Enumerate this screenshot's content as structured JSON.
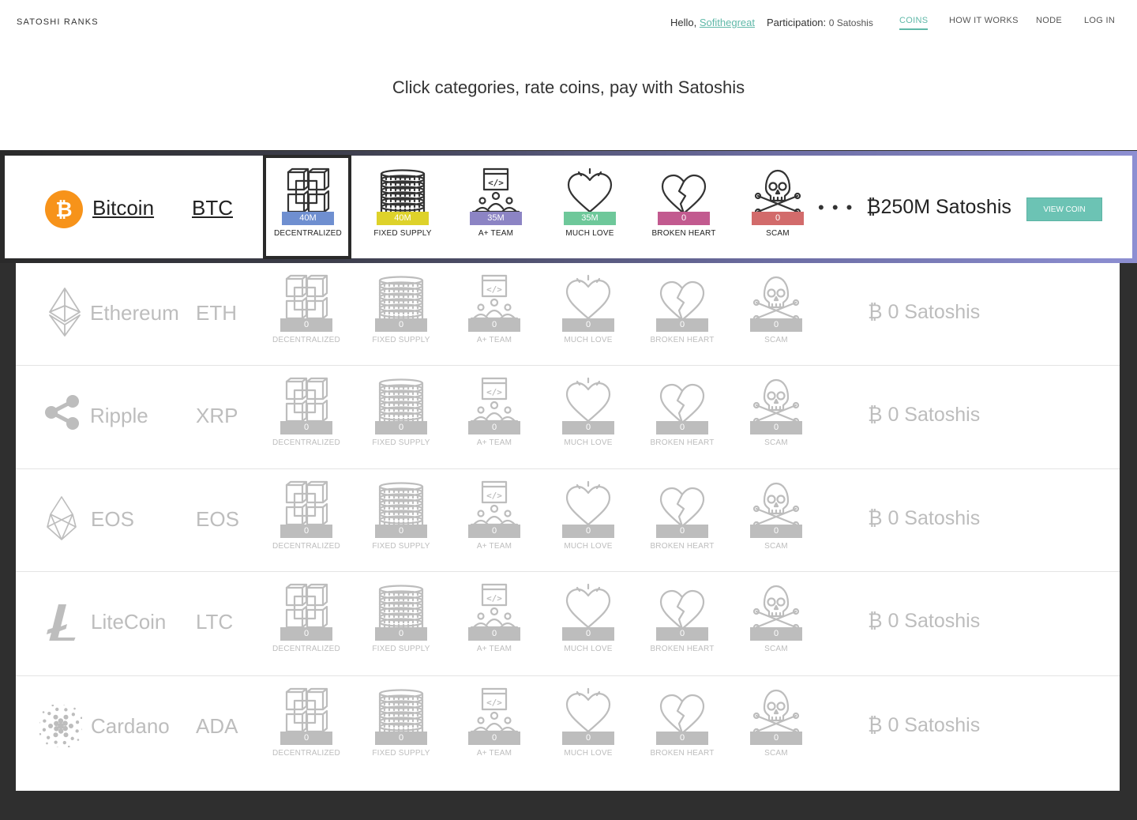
{
  "header": {
    "brand": "SATOSHI RANKS",
    "greeting_prefix": "Hello,",
    "username": "Sofithegreat",
    "participation_label": "Participation:",
    "participation_value": "0 Satoshis",
    "nav": [
      {
        "label": "COINS",
        "active": true
      },
      {
        "label": "HOW IT WORKS",
        "active": false
      },
      {
        "label": "NODE",
        "active": false
      },
      {
        "label": "LOG IN",
        "active": false
      }
    ]
  },
  "tagline": "Click categories, rate coins, pay with Satoshis",
  "categories": [
    {
      "label": "DECENTRALIZED",
      "icon": "blocks-icon"
    },
    {
      "label": "FIXED SUPPLY",
      "icon": "coin-stack-icon"
    },
    {
      "label": "A+ TEAM",
      "icon": "team-icon"
    },
    {
      "label": "MUCH LOVE",
      "icon": "heart-icon"
    },
    {
      "label": "BROKEN HEART",
      "icon": "broken-heart-icon"
    },
    {
      "label": "SCAM",
      "icon": "skull-icon"
    }
  ],
  "category_colors": [
    "#6f8fd0",
    "#ded22a",
    "#8c84c4",
    "#6ec89a",
    "#c25a8f",
    "#d26b6b"
  ],
  "featured": {
    "name": "Bitcoin",
    "symbol": "BTC",
    "logo": "bitcoin-icon",
    "values": [
      "40M",
      "40M",
      "35M",
      "35M",
      "0",
      "0"
    ],
    "more": "• • •",
    "total": "₿250M Satoshis",
    "button": "VIEW COIN"
  },
  "coins": [
    {
      "name": "Ethereum",
      "symbol": "ETH",
      "logo": "ethereum-icon",
      "values": [
        "0",
        "0",
        "0",
        "0",
        "0",
        "0"
      ],
      "total": "₿ 0 Satoshis"
    },
    {
      "name": "Ripple",
      "symbol": "XRP",
      "logo": "ripple-icon",
      "values": [
        "0",
        "0",
        "0",
        "0",
        "0",
        "0"
      ],
      "total": "₿ 0 Satoshis"
    },
    {
      "name": "EOS",
      "symbol": "EOS",
      "logo": "eos-icon",
      "values": [
        "0",
        "0",
        "0",
        "0",
        "0",
        "0"
      ],
      "total": "₿ 0 Satoshis"
    },
    {
      "name": "LiteCoin",
      "symbol": "LTC",
      "logo": "litecoin-icon",
      "values": [
        "0",
        "0",
        "0",
        "0",
        "0",
        "0"
      ],
      "total": "₿ 0 Satoshis"
    },
    {
      "name": "Cardano",
      "symbol": "ADA",
      "logo": "cardano-icon",
      "values": [
        "0",
        "0",
        "0",
        "0",
        "0",
        "0"
      ],
      "total": "₿ 0 Satoshis"
    }
  ]
}
